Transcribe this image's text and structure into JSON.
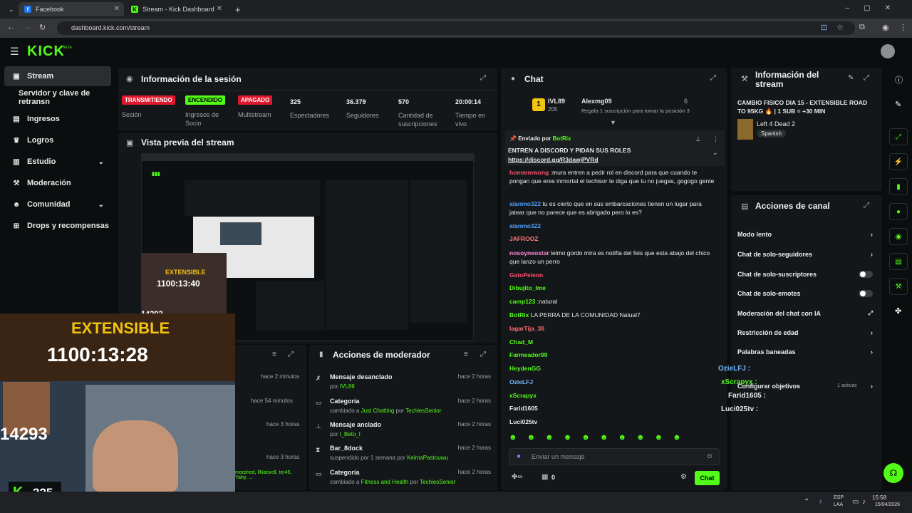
{
  "browser": {
    "tabs": [
      {
        "label": "Facebook"
      },
      {
        "label": "Stream - Kick Dashboard"
      }
    ],
    "new_tab": "+",
    "url": "dashboard.kick.com/stream"
  },
  "nav": {
    "logo": "KICK",
    "beta": "BETA"
  },
  "sidebar": {
    "items": [
      {
        "label": "Stream"
      },
      {
        "label": "Servidor y clave de retransn"
      },
      {
        "label": "Ingresos"
      },
      {
        "label": "Logros"
      },
      {
        "label": "Estudio"
      },
      {
        "label": "Moderación"
      },
      {
        "label": "Comunidad"
      },
      {
        "label": "Drops y recompensas"
      }
    ]
  },
  "session": {
    "title": "Información de la sesión",
    "stats": [
      {
        "badge": "TRANSMITIENDO",
        "label": "Sesión"
      },
      {
        "badge": "ENCENDIDO",
        "label": "Ingresos de Socio"
      },
      {
        "badge": "APAGADO",
        "label": "Multistream"
      },
      {
        "value": "325",
        "label": "Espectadores"
      },
      {
        "value": "36.379",
        "label": "Seguidores"
      },
      {
        "value": "570",
        "label": "Cantidad de suscripciones"
      },
      {
        "value": "20:00:14",
        "label": "Tiempo en vivo"
      }
    ]
  },
  "preview": {
    "title": "Vista previa del stream"
  },
  "overlay": {
    "timer_small": "1100:13:40",
    "label_small": "EXTENSIBLE",
    "count_small": "14292",
    "extensible": "EXTENSIBLE",
    "timer": "1100:13:28",
    "count": "14293",
    "viewers": "325"
  },
  "activity": {
    "items": [
      {
        "time": "hace 2 minutos"
      },
      {
        "time": "hace 54 minutos"
      },
      {
        "time": "hace 3 horas"
      },
      {
        "time": "hace 3 horas"
      }
    ],
    "partial": "morphed, llNativell, ter45, Yahy, ..."
  },
  "modactions": {
    "title": "Acciones de moderador",
    "items": [
      {
        "title": "Mensaje desanclado",
        "sub": "por",
        "user": "IVL89",
        "time": "hace 2 horas"
      },
      {
        "title": "Categoría",
        "sub": "cambiado a",
        "cat": "Just Chatting",
        "by": "por",
        "user": "TechiesSenior",
        "time": "hace 2 horas"
      },
      {
        "title": "Mensaje anclado",
        "sub": "por",
        "user": "l_Beto_l",
        "time": "hace 2 horas"
      },
      {
        "title": "Bar_8dock",
        "sub": "suspendido por 1 semana por",
        "user": "KeimaPastouwu",
        "time": "hace 2 horas"
      },
      {
        "title": "Categoría",
        "sub": "cambiado a",
        "cat": "Fitness and Health",
        "by": "por",
        "user": "TechiesSenior",
        "time": "hace 2 horas"
      }
    ]
  },
  "chat": {
    "title": "Chat",
    "top": {
      "rank": "1",
      "user1": "IVL89",
      "num1": "205",
      "user2": "Alexmg09",
      "num2": "6",
      "gift": "Regala 1 suscripción para tomar la posición 3"
    },
    "pinned": {
      "sent_by": "Enviado por",
      "bot": "BotRix",
      "text": "ENTREN A DISCORD Y PIDAN SUS ROLES",
      "link": "https://discord.gg/R3dawjPVRd"
    },
    "messages": [
      {
        "user": "hommmwong",
        "text": ":mura entren a pedir rol en discord para que cuando te pongan que eres inmortal el techisor te diga que tu no juegas, gogogo gente",
        "color": "#ff4d6d"
      },
      {
        "user": "alanmo322",
        "text": "tu es cierto que en sus embarcaciones tienen un lugar para jatear que no parece que es abrigado pero lo es?",
        "color": "#4d9fff"
      },
      {
        "user": "alanmo322",
        "text": "",
        "color": "#4d9fff"
      },
      {
        "user": "JAFROOZ",
        "text": "",
        "color": "#ff7b7b"
      },
      {
        "user": "nosoyneostar",
        "text": "lelmo gordo mira es notifia del feis que esta abajo del chico que lanzo un perro",
        "color": "#ff8ad8"
      },
      {
        "user": "GatoPeleon",
        "text": "",
        "color": "#ff4d6d"
      },
      {
        "user": "Dibujito_Ime",
        "text": "",
        "color": "#53fc18"
      },
      {
        "user": "camp123",
        "text": ":natural",
        "color": "#53fc18"
      },
      {
        "user": "BotRix",
        "text": "LA PERRA DE LA COMUNIDAD Natual7",
        "color": "#53fc18"
      },
      {
        "user": "lagarTija_38",
        "text": "",
        "color": "#ff6b6b"
      },
      {
        "user": "Chad_M",
        "text": "",
        "color": "#53fc18"
      },
      {
        "user": "Farmeador99",
        "text": "",
        "color": "#53fc18"
      },
      {
        "user": "HeydenGG",
        "text": "",
        "color": "#53fc18"
      },
      {
        "user": "OzieLFJ",
        "text": "",
        "color": "#6fb8ff"
      },
      {
        "user": "xScrapyx",
        "text": "",
        "color": "#53fc18"
      },
      {
        "user": "Farid1605",
        "text": "",
        "color": "#e8e8e8"
      },
      {
        "user": "Luci025tv",
        "text": "",
        "color": "#e8e8e8"
      }
    ],
    "input_placeholder": "Enviar un mensaje",
    "send": "Chat",
    "bottom_count": "0"
  },
  "streaminfo": {
    "title": "Información del stream",
    "stream_title": "CAMBIO FISICO DIA 15 - EXTENSIBLE ROAD TO 95KG 🔥 | 1 SUB = +30 MIN",
    "game": "Left 4 Dead 2",
    "lang": "Spanish"
  },
  "channel": {
    "title": "Acciones de canal",
    "items": [
      {
        "label": "Modo lento"
      },
      {
        "label": "Chat de solo-seguidores"
      },
      {
        "label": "Chat de solo-suscriptores"
      },
      {
        "label": "Chat de solo-emotes"
      },
      {
        "label": "Moderación del chat con IA"
      },
      {
        "label": "Restricción de edad"
      },
      {
        "label": "Palabras baneadas"
      },
      {
        "label": "Configurar objetivos"
      }
    ],
    "active": "1 activas"
  },
  "floating": [
    "OzieLFJ :",
    "xScrapyx :",
    "Farid1605 :",
    "Luci025tv :"
  ],
  "taskbar": {
    "lang1": "ESP",
    "lang2": "LAA",
    "time": "15:58",
    "date": "15/04/2026"
  },
  "colors": {
    "accent": "#53fc18",
    "red": "#e0182d"
  }
}
